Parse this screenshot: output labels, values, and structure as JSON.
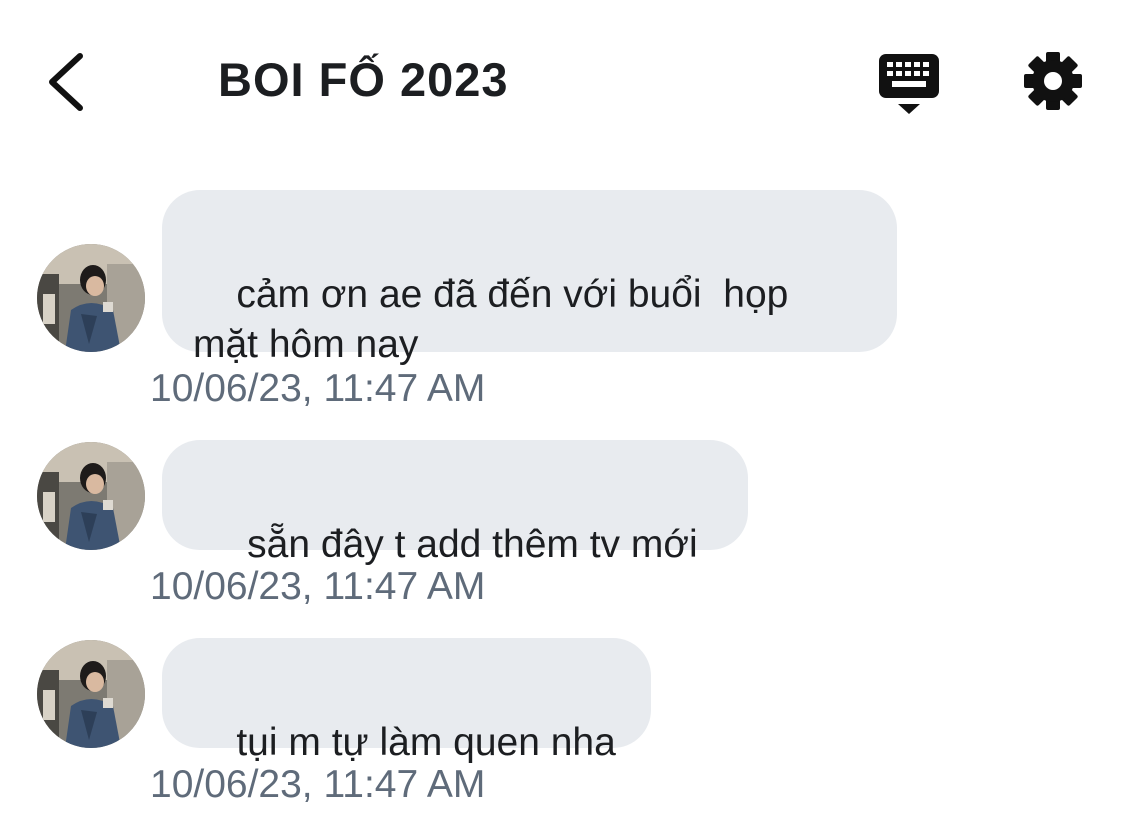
{
  "header": {
    "title": "BOI FỐ 2023",
    "back_icon": "chevron-left-icon",
    "keyboard_icon": "keyboard-icon",
    "settings_icon": "gear-icon"
  },
  "messages": [
    {
      "text": "cảm ơn ae đã đến với buổi  họp\nmặt hôm nay",
      "timestamp": "10/06/23, 11:47 AM"
    },
    {
      "text": " sẵn đây t add thêm tv mới",
      "timestamp": "10/06/23, 11:47 AM"
    },
    {
      "text": "tụi m tự làm quen nha",
      "timestamp": "10/06/23, 11:47 AM"
    }
  ],
  "colors": {
    "bubble": "#e8ebef",
    "timestamp": "#5f6b7a",
    "text": "#1c1e21"
  }
}
